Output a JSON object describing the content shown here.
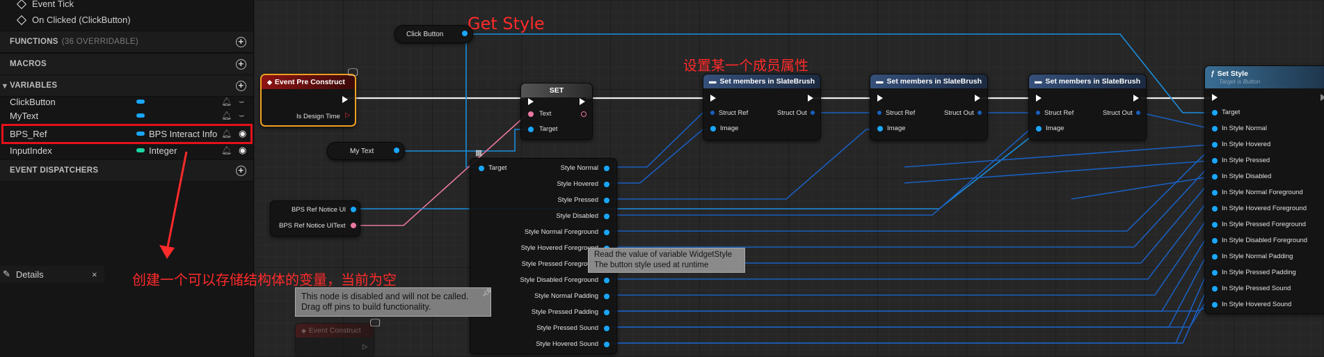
{
  "left_panel": {
    "events": [
      "Event Tick",
      "On Clicked (ClickButton)"
    ],
    "sections": {
      "functions_label": "FUNCTIONS",
      "functions_sub": "(36 OVERRIDABLE)",
      "macros_label": "MACROS",
      "variables_label": "VARIABLES",
      "dispatchers_label": "EVENT DISPATCHERS"
    },
    "variables": [
      {
        "name": "ClickButton",
        "type": "",
        "color": "#1aa7ff"
      },
      {
        "name": "MyText",
        "type": "",
        "color": "#1aa7ff"
      },
      {
        "name": "BPS_Ref",
        "type": "BPS Interact Info",
        "color": "#1aa7ff"
      },
      {
        "name": "InputIndex",
        "type": "Integer",
        "color": "#1dd6a3"
      }
    ],
    "details_tab": "Details",
    "details_close": "×"
  },
  "annotations": {
    "get_style": "Get Style",
    "set_member": "设置某一个成员属性",
    "create_var": "创建一个可以存储结构体的变量，当前为空"
  },
  "graph": {
    "click_button": "Click Button",
    "my_text": "My Text",
    "bps_notice_ui": "BPS Ref Notice UI",
    "bps_notice_uitext": "BPS Ref Notice UIText",
    "event_pre_construct": {
      "title": "Event Pre Construct",
      "pin": "Is Design Time"
    },
    "set_node": {
      "title": "SET",
      "text_pin": "Text",
      "target_pin": "Target"
    },
    "break_node": {
      "target": "Target",
      "outputs": [
        "Style Normal",
        "Style Hovered",
        "Style Pressed",
        "Style Disabled",
        "Style Normal Foreground",
        "Style Hovered Foreground",
        "Style Pressed Foreground",
        "Style Disabled Foreground",
        "Style Normal Padding",
        "Style Pressed Padding",
        "Style Pressed Sound",
        "Style Hovered Sound"
      ]
    },
    "set_members": [
      {
        "title": "Set members in SlateBrush",
        "struct_ref": "Struct Ref",
        "struct_out": "Struct Out",
        "image": "Image"
      },
      {
        "title": "Set members in SlateBrush",
        "struct_ref": "Struct Ref",
        "struct_out": "Struct Out",
        "image": "Image"
      },
      {
        "title": "Set members in SlateBrush",
        "struct_ref": "Struct Ref",
        "struct_out": "Struct Out",
        "image": "Image"
      }
    ],
    "set_style": {
      "title": "Set Style",
      "subtitle": "Target is Button",
      "inputs": [
        "Target",
        "In Style Normal",
        "In Style Hovered",
        "In Style Pressed",
        "In Style Disabled",
        "In Style Normal Foreground",
        "In Style Hovered Foreground",
        "In Style Pressed Foreground",
        "In Style Disabled Foreground",
        "In Style Normal Padding",
        "In Style Pressed Padding",
        "In Style Pressed Sound",
        "In Style Hovered Sound"
      ]
    },
    "tooltip": [
      "Read the value of variable WidgetStyle",
      "The button style used at runtime"
    ],
    "comment": [
      "This node is disabled and will not be called.",
      "Drag off pins to build functionality."
    ],
    "event_construct": "Event Construct"
  }
}
